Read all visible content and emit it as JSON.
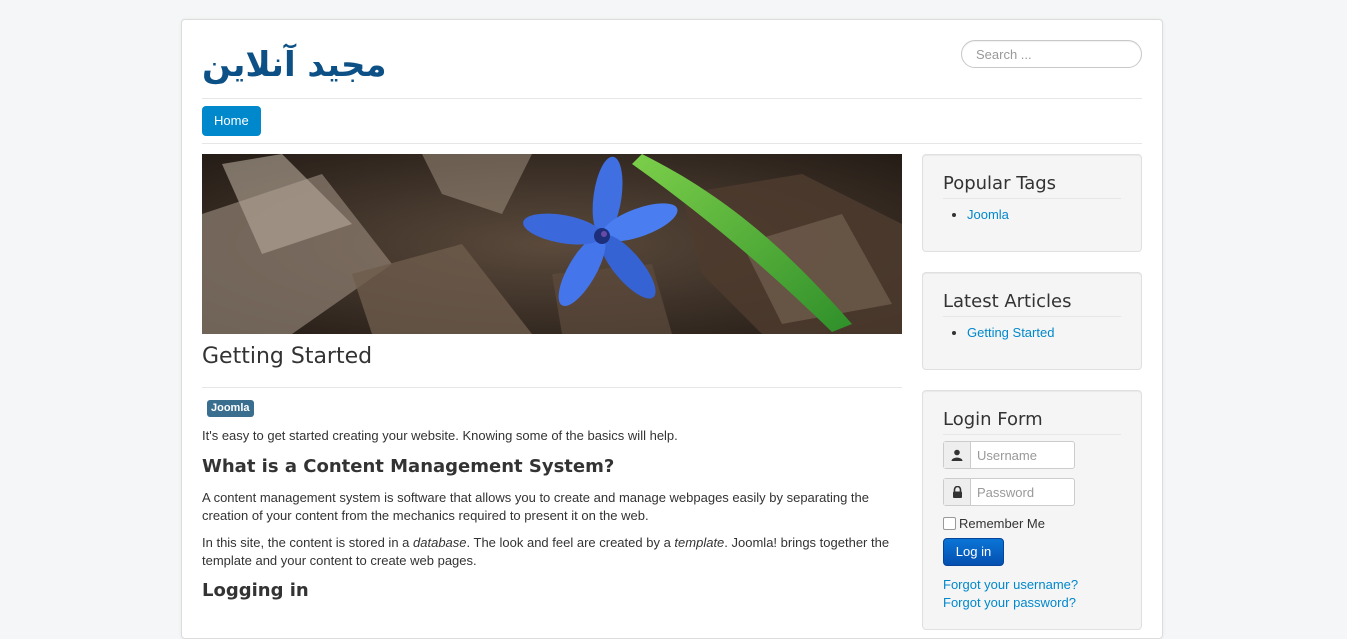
{
  "site": {
    "brand": "مجید آنلاین"
  },
  "search": {
    "placeholder": "Search ..."
  },
  "nav": {
    "home": "Home"
  },
  "article": {
    "title": "Getting Started",
    "tag": "Joomla",
    "intro": "It's easy to get started creating your website. Knowing some of the basics will help.",
    "h_cms": "What is a Content Management System?",
    "p1": "A content management system is software that allows you to create and manage webpages easily by separating the creation of your content from the mechanics required to present it on the web.",
    "p2_a": "In this site, the content is stored in a ",
    "p2_db": "database",
    "p2_b": ". The look and feel are created by a ",
    "p2_tpl": "template",
    "p2_c": ". Joomla! brings together the template and your content to create web pages.",
    "h_login": "Logging in"
  },
  "sidebar": {
    "popular_tags": {
      "title": "Popular Tags",
      "items": [
        "Joomla"
      ]
    },
    "latest_articles": {
      "title": "Latest Articles",
      "items": [
        "Getting Started"
      ]
    },
    "login_form": {
      "title": "Login Form",
      "username_placeholder": "Username",
      "password_placeholder": "Password",
      "remember": "Remember Me",
      "login_button": "Log in",
      "forgot_username": "Forgot your username?",
      "forgot_password": "Forgot your password?"
    }
  },
  "colors": {
    "link": "#0088cc",
    "brand": "#0d5085",
    "tag": "#3a6e8f",
    "button": "#0a75d6"
  }
}
